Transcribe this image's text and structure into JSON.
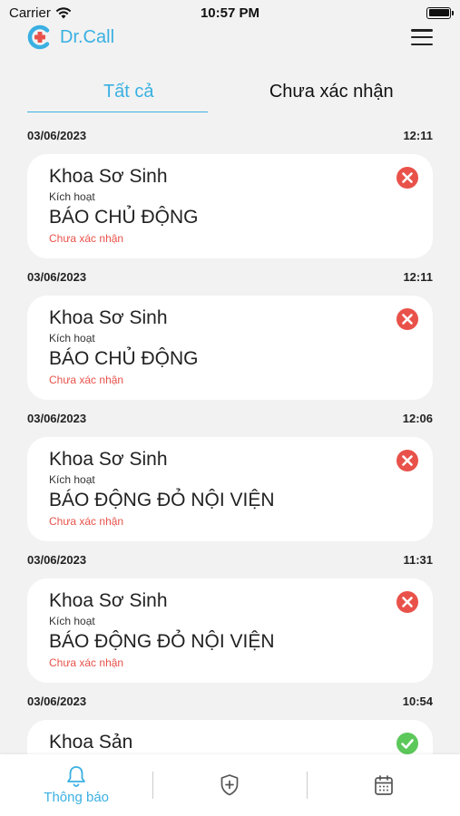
{
  "status_bar": {
    "carrier": "Carrier",
    "time": "10:57 PM"
  },
  "header": {
    "app_name": "Dr.Call",
    "brand_color": "#3ab0e2"
  },
  "tabs": [
    {
      "label": "Tất cả",
      "active": true
    },
    {
      "label": "Chưa xác nhận",
      "active": false
    }
  ],
  "notifications": [
    {
      "date": "03/06/2023",
      "time": "12:11",
      "department": "Khoa Sơ Sinh",
      "action": "Kích hoạt",
      "alert": "BÁO CHỦ ĐỘNG",
      "status": "Chưa xác nhận",
      "icon": "error-icon"
    },
    {
      "date": "03/06/2023",
      "time": "12:11",
      "department": "Khoa Sơ Sinh",
      "action": "Kích hoạt",
      "alert": "BÁO CHỦ ĐỘNG",
      "status": "Chưa xác nhận",
      "icon": "error-icon"
    },
    {
      "date": "03/06/2023",
      "time": "12:06",
      "department": "Khoa Sơ Sinh",
      "action": "Kích hoạt",
      "alert": "BÁO ĐỘNG ĐỎ NỘI VIỆN",
      "status": "Chưa xác nhận",
      "icon": "error-icon"
    },
    {
      "date": "03/06/2023",
      "time": "11:31",
      "department": "Khoa Sơ Sinh",
      "action": "Kích hoạt",
      "alert": "BÁO ĐỘNG ĐỎ NỘI VIỆN",
      "status": "Chưa xác nhận",
      "icon": "error-icon"
    },
    {
      "date": "03/06/2023",
      "time": "10:54",
      "department": "Khoa Sản",
      "action": "",
      "alert": "",
      "status": "",
      "icon": "check-icon"
    }
  ],
  "tabbar": [
    {
      "label": "Thông báo",
      "icon": "bell-icon",
      "active": true
    },
    {
      "label": "",
      "icon": "shield-plus-icon",
      "active": false
    },
    {
      "label": "",
      "icon": "calendar-icon",
      "active": false
    }
  ],
  "colors": {
    "error": "#e8524a",
    "success": "#5cc85a",
    "accent": "#3ab0e2"
  }
}
